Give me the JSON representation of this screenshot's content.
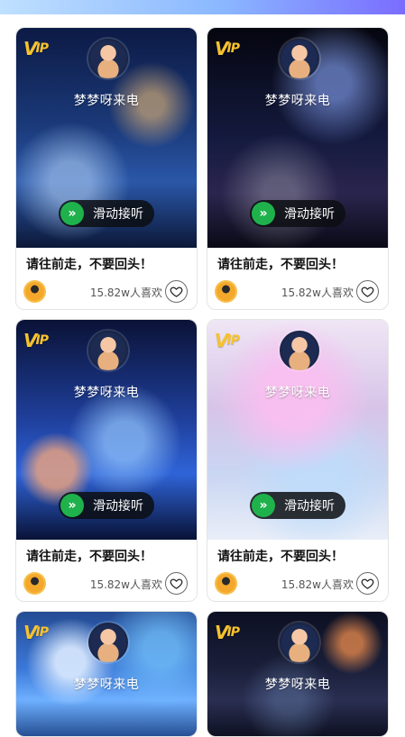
{
  "cards": [
    {
      "id": "1",
      "vip": "VIP",
      "caller_name": "梦梦呀来电",
      "answer_label": "滑动接听",
      "title": "请往前走，不要回头！",
      "likes": "15.82w人喜欢"
    },
    {
      "id": "2",
      "vip": "VIP",
      "caller_name": "梦梦呀来电",
      "answer_label": "滑动接听",
      "title": "请往前走，不要回头！",
      "likes": "15.82w人喜欢"
    },
    {
      "id": "3",
      "vip": "VIP",
      "caller_name": "梦梦呀来电",
      "answer_label": "滑动接听",
      "title": "请往前走，不要回头！",
      "likes": "15.82w人喜欢"
    },
    {
      "id": "4",
      "vip": "VIP",
      "caller_name": "梦梦呀来电",
      "answer_label": "滑动接听",
      "title": "请往前走，不要回头！",
      "likes": "15.82w人喜欢"
    },
    {
      "id": "5",
      "vip": "VIP",
      "caller_name": "梦梦呀来电"
    },
    {
      "id": "6",
      "vip": "VIP",
      "caller_name": "梦梦呀来电"
    }
  ],
  "icons": {
    "answer": "chevrons-right-icon",
    "favorite": "heart-icon",
    "vip": "vip-badge-icon"
  },
  "colors": {
    "answer_green": "#1fb24c",
    "vip_gold": "#f6c22e",
    "text_dark": "#111111",
    "text_muted": "#555555"
  }
}
